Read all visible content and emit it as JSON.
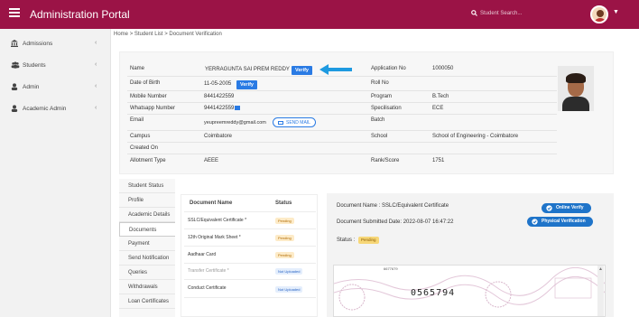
{
  "topbar": {
    "title": "Administration Portal",
    "search_placeholder": "Student Search..."
  },
  "sidebar": {
    "items": [
      {
        "label": "Admissions",
        "icon": "bank-icon"
      },
      {
        "label": "Students",
        "icon": "users-icon"
      },
      {
        "label": "Admin",
        "icon": "user-icon"
      },
      {
        "label": "Academic Admin",
        "icon": "user-icon"
      }
    ]
  },
  "breadcrumb": {
    "home": "Home",
    "student_list": "Student List",
    "current": "Document Verification",
    "sep": ">"
  },
  "profile": {
    "name_label": "Name",
    "name_value": "YERRAGUNTA SAI PREM REDDY",
    "dob_label": "Date of Birth",
    "dob_value": "11-05-2005",
    "mobile_label": "Mobile Number",
    "mobile_value": "8441422559",
    "whatsapp_label": "Whatsapp Number",
    "whatsapp_value": "9441422559",
    "email_label": "Email",
    "email_value": "yeupreemreddy@gmail.com",
    "campus_label": "Campus",
    "campus_value": "Coimbatore",
    "created_label": "Created On",
    "created_value": "",
    "allotment_label": "Allotment Type",
    "allotment_value": "AEEE",
    "appno_label": "Application No",
    "appno_value": "1000050",
    "roll_label": "Roll No",
    "roll_value": "",
    "program_label": "Program",
    "program_value": "B.Tech",
    "spec_label": "Specilisation",
    "spec_value": "ECE",
    "batch_label": "Batch",
    "batch_value": "",
    "school_label": "School",
    "school_value": "School of Engineering - Coimbatore",
    "rank_label": "Rank/Score",
    "rank_value": "1751",
    "verify_label": "Verify",
    "send_mail_label": "SEND MAIL"
  },
  "tabs": [
    "Student Status",
    "Profile",
    "Academic Details",
    "Documents",
    "Payment",
    "Send Notification",
    "Queries",
    "Withdrawals",
    "Loan Certificates"
  ],
  "documents": {
    "col_name": "Document Name",
    "col_status": "Status",
    "rows": [
      {
        "name": "SSLC/Equivalent Certificate *",
        "status": "Pending",
        "kind": "pending"
      },
      {
        "name": "12th Original Mark Sheet *",
        "status": "Pending",
        "kind": "pending"
      },
      {
        "name": "Aadhaar Card",
        "status": "Pending",
        "kind": "pending"
      },
      {
        "name": "Transfer Certificate *",
        "status": "Not Uploaded",
        "kind": "notup"
      },
      {
        "name": "Conduct Certificate",
        "status": "Not Uploaded",
        "kind": "notup"
      }
    ]
  },
  "detail": {
    "doc_name": "Document Name : SSLC/Equivalent Certificate",
    "submitted": "Document Submitted Date: 2022-08-07 16:47:22",
    "status_label": "Status :",
    "status_value": "Pending",
    "online_verify": "Online Verify",
    "physical_verify": "Physical Verification",
    "cert_number": "0565794",
    "cert_serial": "6677679"
  },
  "colors": {
    "brand": "#9b1346",
    "accent": "#2a7be4"
  }
}
